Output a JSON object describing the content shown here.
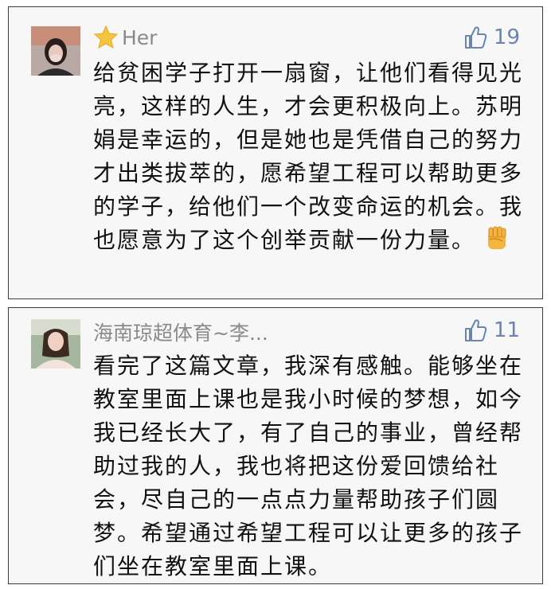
{
  "comments": [
    {
      "username": "Her",
      "likes": "19",
      "text": "给贫困学子打开一扇窗，让他们看得见光亮，这样的人生，才会更积极向上。苏明娟是幸运的，但是她也是凭借自己的努力才出类拔萃的，愿希望工程可以帮助更多的学子，给他们一个改变命运的机会。我也愿意为了这个创举贡献一份力量。",
      "username_icon": "star-emoji",
      "trailing_icon": "fist-emoji"
    },
    {
      "username": "海南琼超体育~李...",
      "likes": "11",
      "text": "看完了这篇文章，我深有感触。能够坐在教室里面上课也是我小时候的梦想，如今我已经长大了，有了自己的事业，曾经帮助过我的人，我也将把这份爱回馈给社会，尽自己的一点点力量帮助孩子们圆梦。希望通过希望工程可以让更多的孩子们坐在教室里面上课。"
    }
  ],
  "colors": {
    "username": "#8a8a8a",
    "likes": "#6a84b0",
    "text": "#111111",
    "card_bg": "#f7f7f7",
    "border": "#3a3a3a"
  }
}
